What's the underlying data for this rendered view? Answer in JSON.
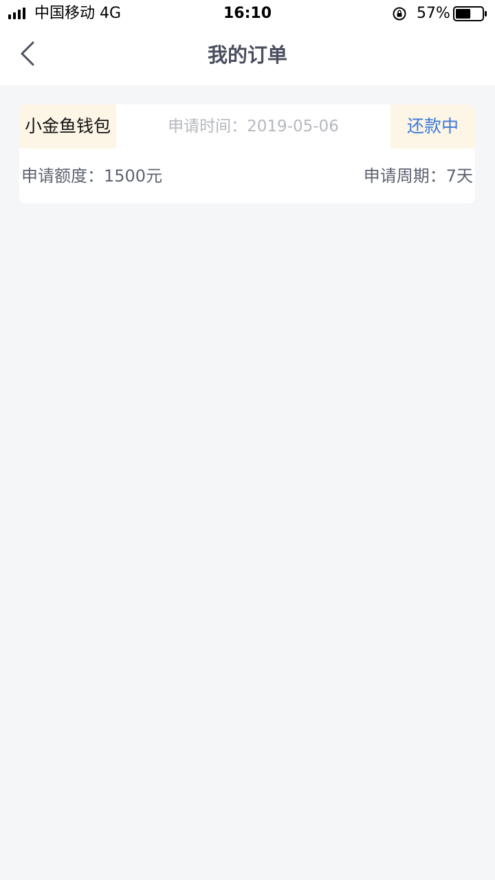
{
  "status_bar": {
    "carrier": "中国移动   4G",
    "time": "16:10",
    "battery": "57%",
    "battery_level": 0.57
  },
  "nav": {
    "title": "我的订单",
    "back_icon": "chevron-left-icon"
  },
  "order": {
    "product": "小金鱼钱包",
    "apply_time": "申请时间：2019-05-06",
    "status": "还款中",
    "amount": "申请额度：1500元",
    "period": "申请周期：7天"
  },
  "colors": {
    "tag_bg": "#fdf6e7",
    "status_text": "#3c78d8",
    "page_bg": "#f5f6f8"
  }
}
